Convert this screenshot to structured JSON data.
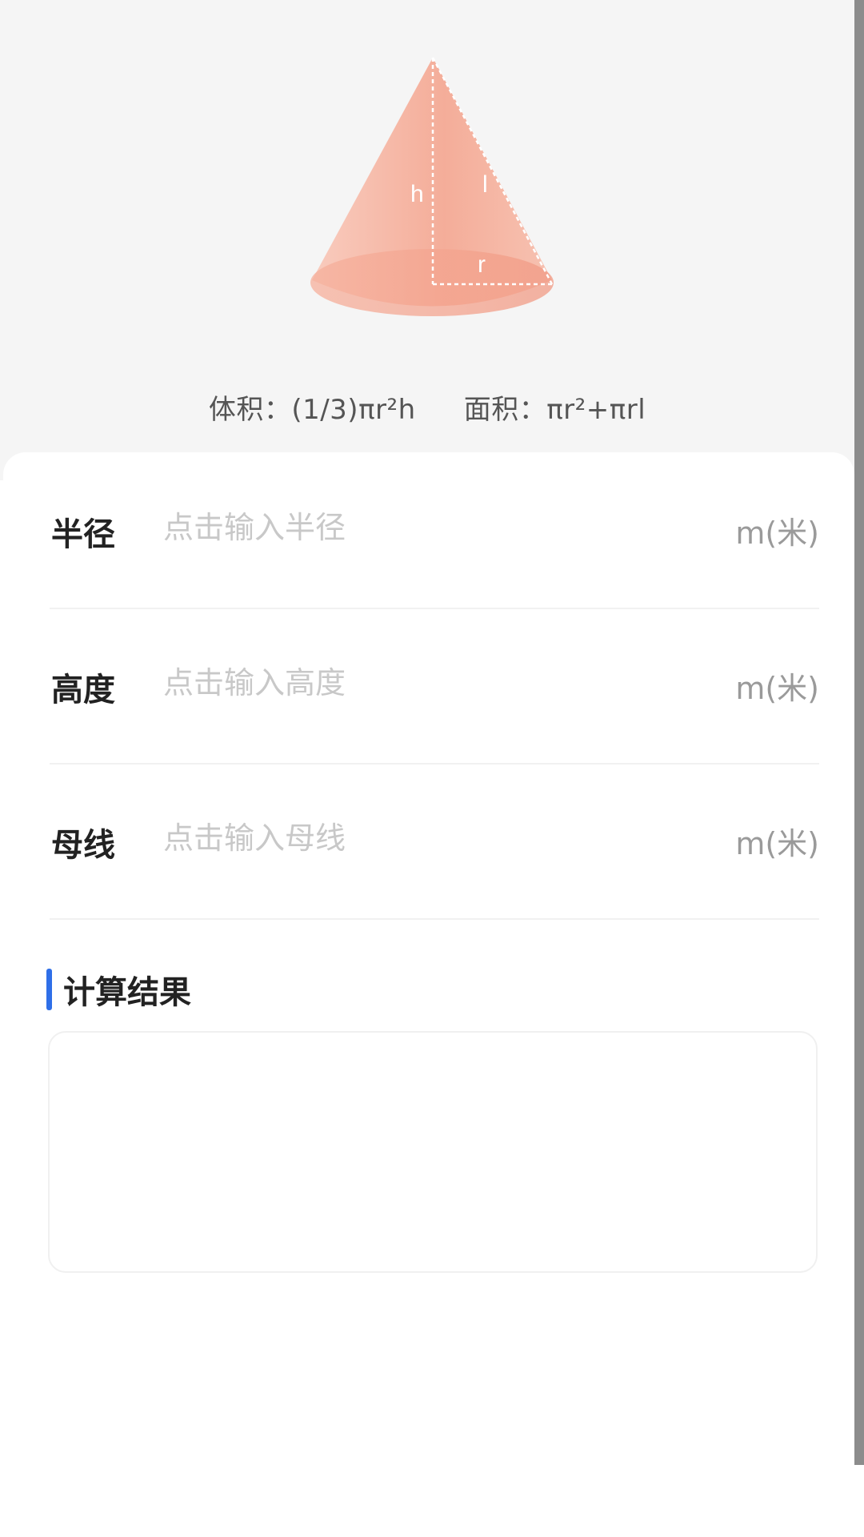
{
  "header": {
    "formula_volume": "体积：(1/3)πr²h",
    "formula_area": "面积：πr²+πrl",
    "cone_labels": {
      "height": "h",
      "slant": "l",
      "radius": "r"
    }
  },
  "fields": [
    {
      "label": "半径",
      "placeholder": "点击输入半径",
      "unit": "m(米)",
      "value": ""
    },
    {
      "label": "高度",
      "placeholder": "点击输入高度",
      "unit": "m(米)",
      "value": ""
    },
    {
      "label": "母线",
      "placeholder": "点击输入母线",
      "unit": "m(米)",
      "value": ""
    }
  ],
  "result": {
    "title": "计算结果",
    "text": ""
  },
  "colors": {
    "accent": "#2f6fe8",
    "cone": "#f29a85",
    "header_bg": "#f5f5f5"
  }
}
